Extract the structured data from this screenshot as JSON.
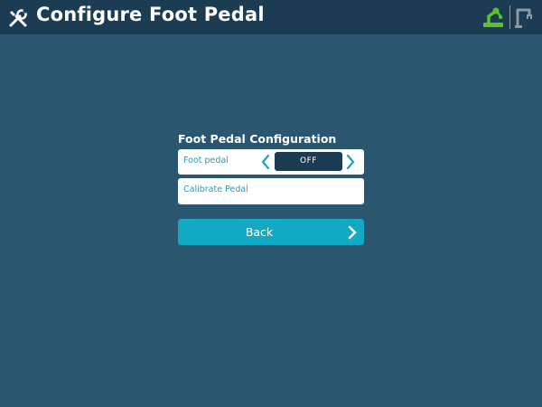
{
  "header": {
    "title": "Configure Foot Pedal",
    "icons": {
      "left": "tools-icon",
      "right": [
        "robot-status-icon",
        "robot-arm-icon"
      ]
    }
  },
  "section": {
    "title": "Foot Pedal Configuration"
  },
  "foot_pedal": {
    "label": "Foot pedal",
    "value": "OFF",
    "prev_icon": "chevron-left-icon",
    "next_icon": "chevron-right-icon"
  },
  "calibrate": {
    "label": "Calibrate Pedal"
  },
  "back": {
    "label": "Back",
    "icon": "chevron-right-icon"
  },
  "colors": {
    "background": "#2b5670",
    "header": "#1b3c52",
    "accent": "#12a9c4",
    "label_text": "#1aa3bf",
    "status_green": "#5cc22a"
  }
}
